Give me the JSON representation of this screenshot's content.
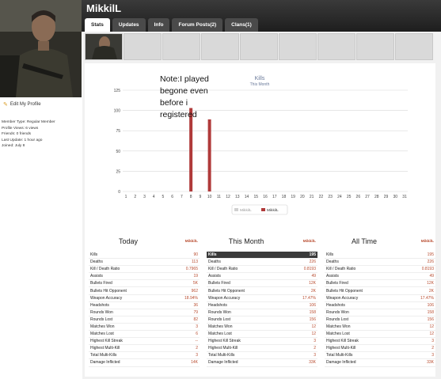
{
  "header": {
    "username": "MikkilL"
  },
  "tabs": [
    {
      "label": "Stats"
    },
    {
      "label": "Updates"
    },
    {
      "label": "Info"
    },
    {
      "label": "Forum Posts(2)"
    },
    {
      "label": "Clans(1)"
    }
  ],
  "sidebar": {
    "edit_profile": "Edit My Profile",
    "info_lines": [
      "Member Type: Regular Member",
      "Profile Views: 6 views",
      "Friends: 0 friends",
      "Last Update: 1 hour ago",
      "Joined: July 8"
    ]
  },
  "note": "Note:I played\nbegone even\nbefore i\nregistered",
  "chart_data": {
    "type": "bar",
    "title": "Kills",
    "subtitle": "This Month",
    "categories": [
      "1",
      "2",
      "3",
      "4",
      "5",
      "6",
      "7",
      "8",
      "9",
      "10",
      "11",
      "12",
      "13",
      "14",
      "15",
      "16",
      "17",
      "18",
      "19",
      "20",
      "21",
      "22",
      "23",
      "24",
      "25",
      "26",
      "27",
      "28",
      "29",
      "30",
      "31"
    ],
    "series": [
      {
        "name": "MikkilL",
        "values": [
          0,
          0,
          0,
          0,
          0,
          0,
          0,
          103,
          0,
          89,
          0,
          0,
          0,
          0,
          0,
          0,
          0,
          0,
          0,
          0,
          0,
          0,
          0,
          0,
          0,
          0,
          0,
          0,
          0,
          0,
          0
        ]
      }
    ],
    "yticks": [
      "0",
      "25",
      "50",
      "75",
      "100",
      "125"
    ],
    "ylim": [
      0,
      125
    ],
    "grid": true,
    "legend": [
      "MikkilL",
      "MikkilL"
    ],
    "legend_placement": "bottom-center",
    "colors": {
      "bar": "#b03a3a",
      "grid": "#d8d8d8"
    }
  },
  "columns": [
    {
      "title": "Today",
      "user": "MikkilL",
      "rows": [
        [
          "Kills",
          "90"
        ],
        [
          "Deaths",
          "113"
        ],
        [
          "Kill / Death Ratio",
          "0.7965"
        ],
        [
          "Assists",
          "19"
        ],
        [
          "Bullets Fired",
          "5K"
        ],
        [
          "Bullets Hit Opponent",
          "962"
        ],
        [
          "Weapon Accuracy",
          "18.94%"
        ],
        [
          "Headshots",
          "36"
        ],
        [
          "Rounds Won",
          "79"
        ],
        [
          "Rounds Lost",
          "82"
        ],
        [
          "Matches Won",
          "3"
        ],
        [
          "Matches Lost",
          "6"
        ],
        [
          "Highest Kill Streak",
          "--"
        ],
        [
          "Highest Multi-Kill",
          "2"
        ],
        [
          "Total Multi-Kills",
          "3"
        ],
        [
          "Damage Inflicted",
          "14K"
        ]
      ]
    },
    {
      "title": "This Month",
      "user": "MikkilL",
      "rows": [
        [
          "Kills",
          "195"
        ],
        [
          "Deaths",
          "226"
        ],
        [
          "Kill / Death Ratio",
          "0.8193"
        ],
        [
          "Assists",
          "49"
        ],
        [
          "Bullets Fired",
          "12K"
        ],
        [
          "Bullets Hit Opponent",
          "2K"
        ],
        [
          "Weapon Accuracy",
          "17.47%"
        ],
        [
          "Headshots",
          "106"
        ],
        [
          "Rounds Won",
          "158"
        ],
        [
          "Rounds Lost",
          "156"
        ],
        [
          "Matches Won",
          "12"
        ],
        [
          "Matches Lost",
          "12"
        ],
        [
          "Highest Kill Streak",
          "3"
        ],
        [
          "Highest Multi-Kill",
          "2"
        ],
        [
          "Total Multi-Kills",
          "3"
        ],
        [
          "Damage Inflicted",
          "33K"
        ]
      ]
    },
    {
      "title": "All Time",
      "user": "MikkilL",
      "rows": [
        [
          "Kills",
          "195"
        ],
        [
          "Deaths",
          "226"
        ],
        [
          "Kill / Death Ratio",
          "0.8193"
        ],
        [
          "Assists",
          "49"
        ],
        [
          "Bullets Fired",
          "12K"
        ],
        [
          "Bullets Hit Opponent",
          "2K"
        ],
        [
          "Weapon Accuracy",
          "17.47%"
        ],
        [
          "Headshots",
          "106"
        ],
        [
          "Rounds Won",
          "158"
        ],
        [
          "Rounds Lost",
          "156"
        ],
        [
          "Matches Won",
          "12"
        ],
        [
          "Matches Lost",
          "12"
        ],
        [
          "Highest Kill Streak",
          "3"
        ],
        [
          "Highest Multi-Kill",
          "2"
        ],
        [
          "Total Multi-Kills",
          "3"
        ],
        [
          "Damage Inflicted",
          "33K"
        ]
      ]
    }
  ]
}
